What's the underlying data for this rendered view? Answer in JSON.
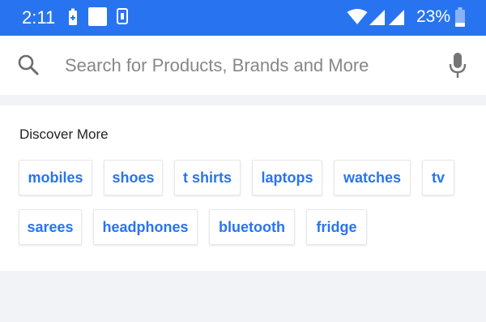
{
  "status_bar": {
    "time": "2:11",
    "battery_percent": "23%",
    "battery_level": 0.23,
    "icons": [
      "battery-saver-icon",
      "notification-square-icon",
      "sim-icon",
      "wifi-icon",
      "cellular-signal-icon",
      "battery-icon"
    ]
  },
  "search": {
    "placeholder": "Search for Products, Brands and More",
    "value": ""
  },
  "discover": {
    "title": "Discover More",
    "chips": [
      {
        "label": "mobiles"
      },
      {
        "label": "shoes"
      },
      {
        "label": "t shirts"
      },
      {
        "label": "laptops"
      },
      {
        "label": "watches"
      },
      {
        "label": "tv"
      },
      {
        "label": "sarees"
      },
      {
        "label": "headphones"
      },
      {
        "label": "bluetooth"
      },
      {
        "label": "fridge"
      }
    ]
  },
  "colors": {
    "status_bar": "#2874f0",
    "chip_text": "#2874f0",
    "page_background": "#f1f3f6"
  }
}
